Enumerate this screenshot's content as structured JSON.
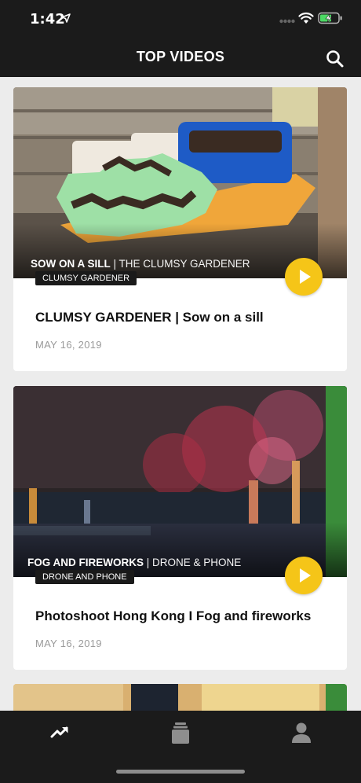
{
  "status_bar": {
    "time": "1:42"
  },
  "header": {
    "title": "TOP VIDEOS"
  },
  "videos": [
    {
      "caption_bold": "SOW ON A SILL",
      "caption_rest": " | THE CLUMSY GARDENER",
      "tag": "CLUMSY GARDENER",
      "title": "CLUMSY GARDENER | Sow on a sill",
      "date": "MAY 16, 2019"
    },
    {
      "caption_bold": "FOG AND FIREWORKS",
      "caption_rest": " | DRONE & PHONE",
      "tag": "DRONE AND PHONE",
      "title": "Photoshoot Hong Kong I Fog and fireworks",
      "date": "MAY 16, 2019"
    }
  ],
  "tabs": [
    {
      "icon": "trending-icon",
      "active": true
    },
    {
      "icon": "library-stack-icon",
      "active": false
    },
    {
      "icon": "profile-icon",
      "active": false
    }
  ],
  "colors": {
    "bar": "#1b1b1b",
    "accent": "#f5c518",
    "background": "#ececec"
  }
}
